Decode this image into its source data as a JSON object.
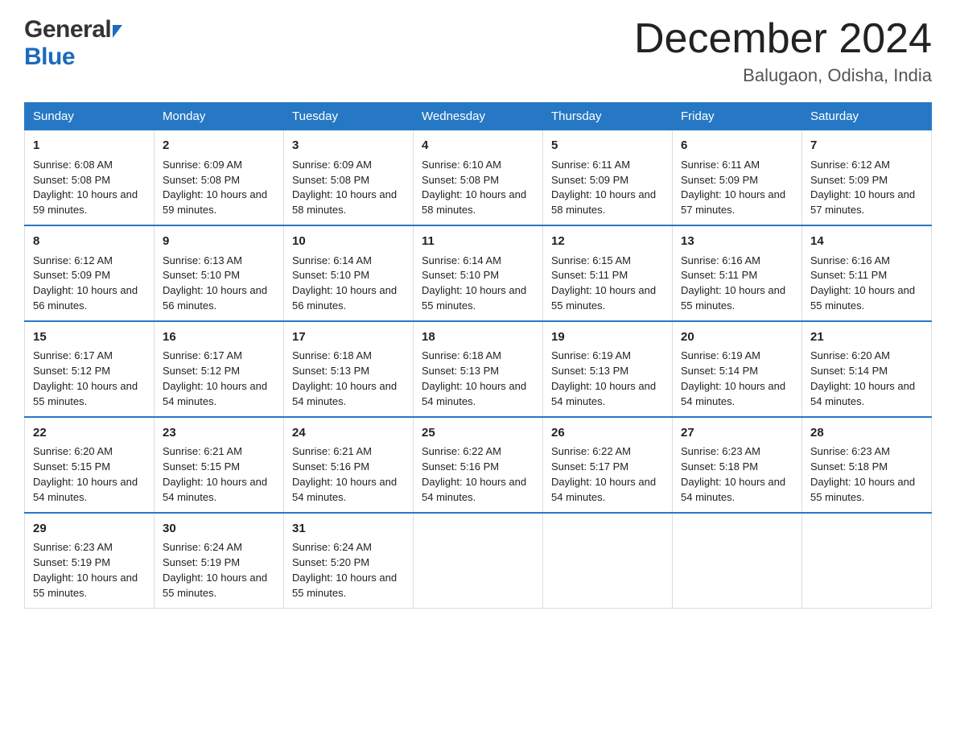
{
  "header": {
    "logo_line1": "General",
    "logo_line2": "Blue",
    "month_title": "December 2024",
    "location": "Balugaon, Odisha, India"
  },
  "weekdays": [
    "Sunday",
    "Monday",
    "Tuesday",
    "Wednesday",
    "Thursday",
    "Friday",
    "Saturday"
  ],
  "weeks": [
    [
      {
        "day": "1",
        "sunrise": "Sunrise: 6:08 AM",
        "sunset": "Sunset: 5:08 PM",
        "daylight": "Daylight: 10 hours and 59 minutes."
      },
      {
        "day": "2",
        "sunrise": "Sunrise: 6:09 AM",
        "sunset": "Sunset: 5:08 PM",
        "daylight": "Daylight: 10 hours and 59 minutes."
      },
      {
        "day": "3",
        "sunrise": "Sunrise: 6:09 AM",
        "sunset": "Sunset: 5:08 PM",
        "daylight": "Daylight: 10 hours and 58 minutes."
      },
      {
        "day": "4",
        "sunrise": "Sunrise: 6:10 AM",
        "sunset": "Sunset: 5:08 PM",
        "daylight": "Daylight: 10 hours and 58 minutes."
      },
      {
        "day": "5",
        "sunrise": "Sunrise: 6:11 AM",
        "sunset": "Sunset: 5:09 PM",
        "daylight": "Daylight: 10 hours and 58 minutes."
      },
      {
        "day": "6",
        "sunrise": "Sunrise: 6:11 AM",
        "sunset": "Sunset: 5:09 PM",
        "daylight": "Daylight: 10 hours and 57 minutes."
      },
      {
        "day": "7",
        "sunrise": "Sunrise: 6:12 AM",
        "sunset": "Sunset: 5:09 PM",
        "daylight": "Daylight: 10 hours and 57 minutes."
      }
    ],
    [
      {
        "day": "8",
        "sunrise": "Sunrise: 6:12 AM",
        "sunset": "Sunset: 5:09 PM",
        "daylight": "Daylight: 10 hours and 56 minutes."
      },
      {
        "day": "9",
        "sunrise": "Sunrise: 6:13 AM",
        "sunset": "Sunset: 5:10 PM",
        "daylight": "Daylight: 10 hours and 56 minutes."
      },
      {
        "day": "10",
        "sunrise": "Sunrise: 6:14 AM",
        "sunset": "Sunset: 5:10 PM",
        "daylight": "Daylight: 10 hours and 56 minutes."
      },
      {
        "day": "11",
        "sunrise": "Sunrise: 6:14 AM",
        "sunset": "Sunset: 5:10 PM",
        "daylight": "Daylight: 10 hours and 55 minutes."
      },
      {
        "day": "12",
        "sunrise": "Sunrise: 6:15 AM",
        "sunset": "Sunset: 5:11 PM",
        "daylight": "Daylight: 10 hours and 55 minutes."
      },
      {
        "day": "13",
        "sunrise": "Sunrise: 6:16 AM",
        "sunset": "Sunset: 5:11 PM",
        "daylight": "Daylight: 10 hours and 55 minutes."
      },
      {
        "day": "14",
        "sunrise": "Sunrise: 6:16 AM",
        "sunset": "Sunset: 5:11 PM",
        "daylight": "Daylight: 10 hours and 55 minutes."
      }
    ],
    [
      {
        "day": "15",
        "sunrise": "Sunrise: 6:17 AM",
        "sunset": "Sunset: 5:12 PM",
        "daylight": "Daylight: 10 hours and 55 minutes."
      },
      {
        "day": "16",
        "sunrise": "Sunrise: 6:17 AM",
        "sunset": "Sunset: 5:12 PM",
        "daylight": "Daylight: 10 hours and 54 minutes."
      },
      {
        "day": "17",
        "sunrise": "Sunrise: 6:18 AM",
        "sunset": "Sunset: 5:13 PM",
        "daylight": "Daylight: 10 hours and 54 minutes."
      },
      {
        "day": "18",
        "sunrise": "Sunrise: 6:18 AM",
        "sunset": "Sunset: 5:13 PM",
        "daylight": "Daylight: 10 hours and 54 minutes."
      },
      {
        "day": "19",
        "sunrise": "Sunrise: 6:19 AM",
        "sunset": "Sunset: 5:13 PM",
        "daylight": "Daylight: 10 hours and 54 minutes."
      },
      {
        "day": "20",
        "sunrise": "Sunrise: 6:19 AM",
        "sunset": "Sunset: 5:14 PM",
        "daylight": "Daylight: 10 hours and 54 minutes."
      },
      {
        "day": "21",
        "sunrise": "Sunrise: 6:20 AM",
        "sunset": "Sunset: 5:14 PM",
        "daylight": "Daylight: 10 hours and 54 minutes."
      }
    ],
    [
      {
        "day": "22",
        "sunrise": "Sunrise: 6:20 AM",
        "sunset": "Sunset: 5:15 PM",
        "daylight": "Daylight: 10 hours and 54 minutes."
      },
      {
        "day": "23",
        "sunrise": "Sunrise: 6:21 AM",
        "sunset": "Sunset: 5:15 PM",
        "daylight": "Daylight: 10 hours and 54 minutes."
      },
      {
        "day": "24",
        "sunrise": "Sunrise: 6:21 AM",
        "sunset": "Sunset: 5:16 PM",
        "daylight": "Daylight: 10 hours and 54 minutes."
      },
      {
        "day": "25",
        "sunrise": "Sunrise: 6:22 AM",
        "sunset": "Sunset: 5:16 PM",
        "daylight": "Daylight: 10 hours and 54 minutes."
      },
      {
        "day": "26",
        "sunrise": "Sunrise: 6:22 AM",
        "sunset": "Sunset: 5:17 PM",
        "daylight": "Daylight: 10 hours and 54 minutes."
      },
      {
        "day": "27",
        "sunrise": "Sunrise: 6:23 AM",
        "sunset": "Sunset: 5:18 PM",
        "daylight": "Daylight: 10 hours and 54 minutes."
      },
      {
        "day": "28",
        "sunrise": "Sunrise: 6:23 AM",
        "sunset": "Sunset: 5:18 PM",
        "daylight": "Daylight: 10 hours and 55 minutes."
      }
    ],
    [
      {
        "day": "29",
        "sunrise": "Sunrise: 6:23 AM",
        "sunset": "Sunset: 5:19 PM",
        "daylight": "Daylight: 10 hours and 55 minutes."
      },
      {
        "day": "30",
        "sunrise": "Sunrise: 6:24 AM",
        "sunset": "Sunset: 5:19 PM",
        "daylight": "Daylight: 10 hours and 55 minutes."
      },
      {
        "day": "31",
        "sunrise": "Sunrise: 6:24 AM",
        "sunset": "Sunset: 5:20 PM",
        "daylight": "Daylight: 10 hours and 55 minutes."
      },
      null,
      null,
      null,
      null
    ]
  ]
}
